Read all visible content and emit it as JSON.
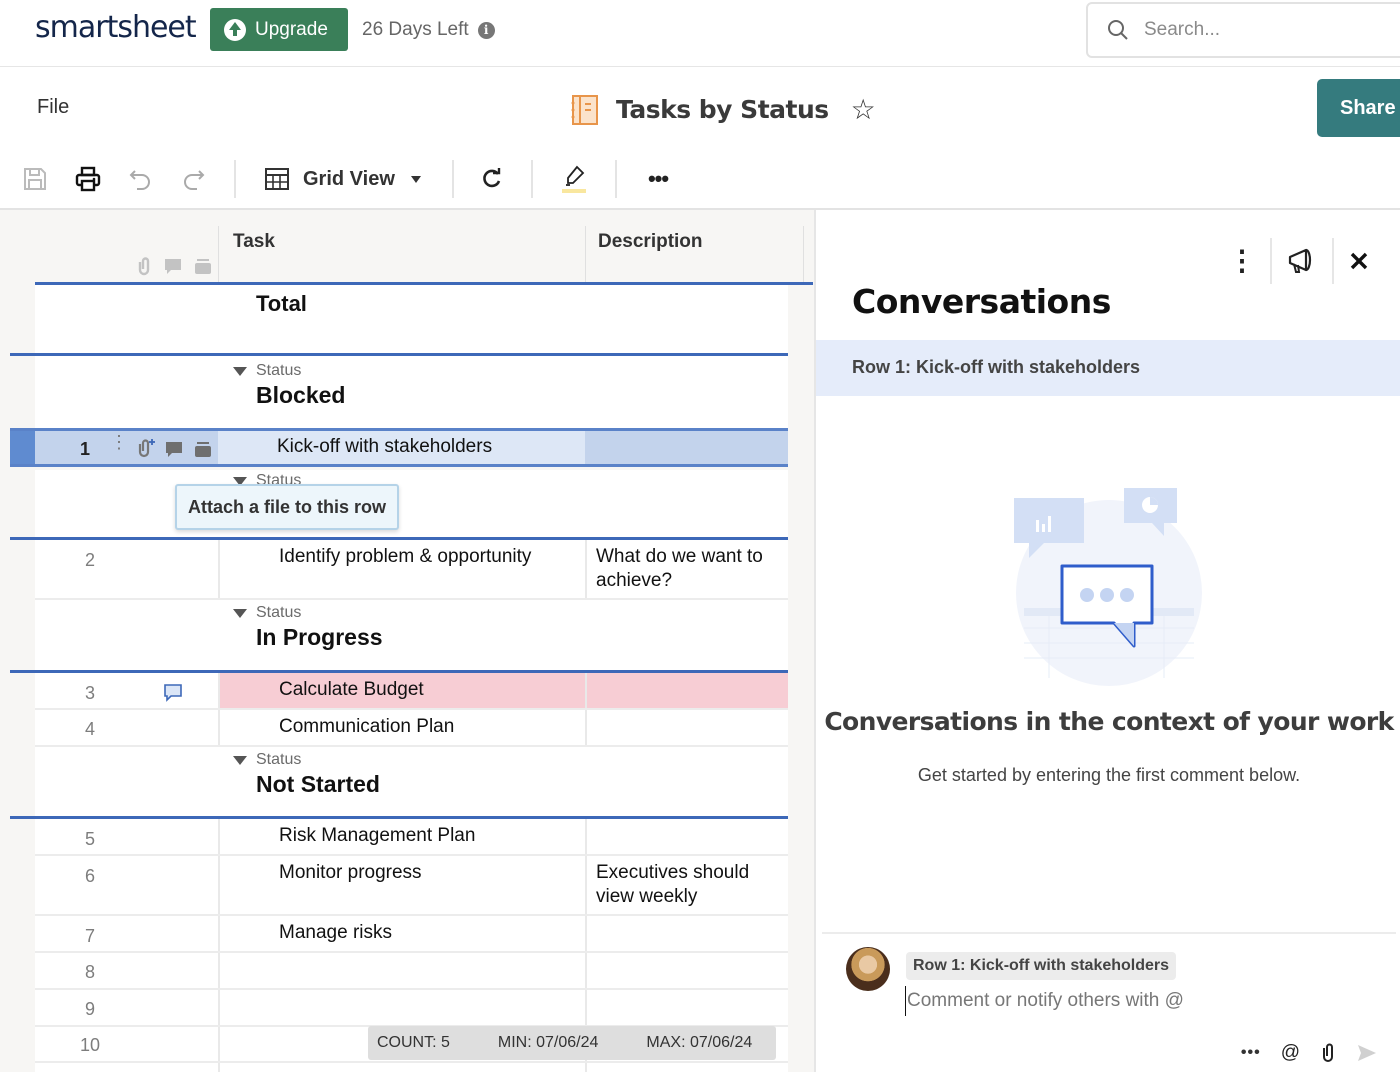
{
  "topbar": {
    "logo": "smartsheet",
    "upgrade_label": "Upgrade",
    "days_left": "26 Days Left",
    "search_placeholder": "Search..."
  },
  "titlebar": {
    "file_menu": "File",
    "sheet_title": "Tasks by Status",
    "share_label": "Share"
  },
  "toolbar": {
    "view_label": "Grid View",
    "highlight_color": "#f9e79f"
  },
  "grid": {
    "columns": [
      "Task",
      "Description"
    ],
    "total_label": "Total",
    "group_field": "Status",
    "groups": [
      {
        "title": "Blocked"
      },
      {
        "title": "In Progress"
      },
      {
        "title": "Not Started"
      }
    ],
    "rows": [
      {
        "num": "1",
        "task": "Kick-off with stakeholders",
        "description": ""
      },
      {
        "num": "2",
        "task": "Identify problem & opportunity",
        "description": "What do we want to achieve?"
      },
      {
        "num": "3",
        "task": "Calculate Budget",
        "description": ""
      },
      {
        "num": "4",
        "task": "Communication Plan",
        "description": ""
      },
      {
        "num": "5",
        "task": "Risk Management Plan",
        "description": ""
      },
      {
        "num": "6",
        "task": "Monitor progress",
        "description": "Executives should view weekly"
      },
      {
        "num": "7",
        "task": "Manage risks",
        "description": ""
      },
      {
        "num": "8",
        "task": "",
        "description": ""
      },
      {
        "num": "9",
        "task": "",
        "description": ""
      },
      {
        "num": "10",
        "task": "",
        "description": ""
      }
    ],
    "tooltip": "Attach a file to this row",
    "summary": {
      "count": "COUNT:  5",
      "min": "MIN:  07/06/24",
      "max": "MAX:  07/06/24"
    },
    "colors": {
      "selected_row": "#dde7f6",
      "selected_desc": "#c3d3ec",
      "highlight_row": "#f7cdd4",
      "group_line": "#3d68b8"
    }
  },
  "conversations": {
    "title": "Conversations",
    "context": "Row 1: Kick-off with stakeholders",
    "empty_title": "Conversations in the context of your work",
    "empty_subtitle": "Get started by entering the first comment below.",
    "chip": "Row 1: Kick-off with stakeholders",
    "comment_placeholder": "Comment or notify others with @"
  }
}
